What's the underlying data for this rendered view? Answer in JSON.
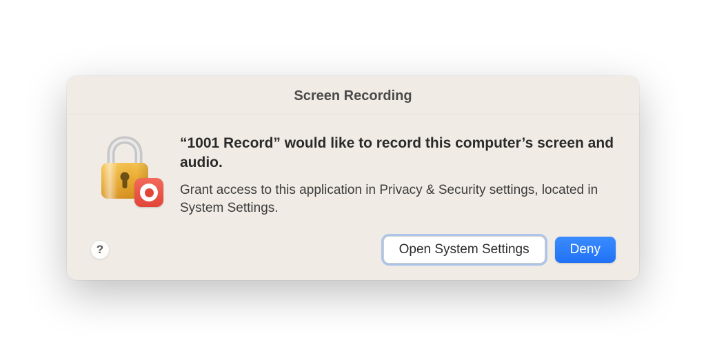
{
  "dialog": {
    "title": "Screen Recording",
    "messagePrimary": "“1001 Record” would like to record this computer’s screen and audio.",
    "messageSecondary": "Grant access to this application in Privacy & Security settings, located in System Settings.",
    "helpLabel": "?",
    "openSettingsLabel": "Open System Settings",
    "denyLabel": "Deny"
  }
}
